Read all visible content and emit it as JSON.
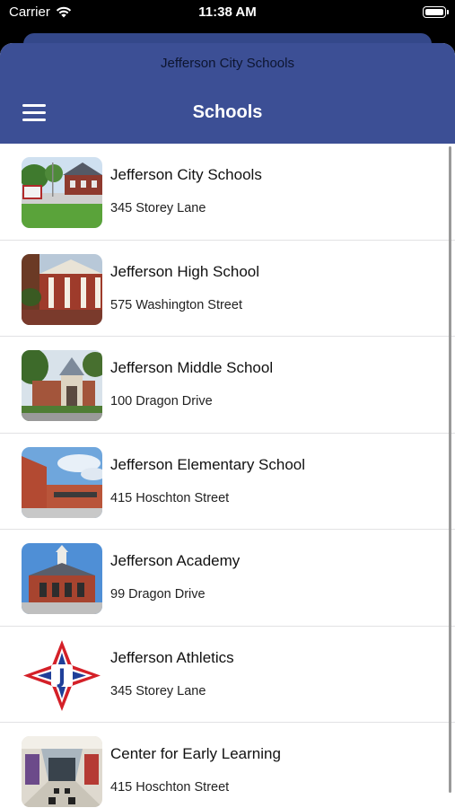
{
  "status_bar": {
    "carrier": "Carrier",
    "time": "11:38 AM"
  },
  "header": {
    "parent_title": "Jefferson City Schools",
    "title": "Schools"
  },
  "colors": {
    "header_bg": "#3c4f95",
    "title_text": "#ffffff"
  },
  "schools": [
    {
      "name": "Jefferson City Schools",
      "address": "345 Storey Lane",
      "icon": "building-photo"
    },
    {
      "name": "Jefferson High School",
      "address": "575 Washington Street",
      "icon": "building-photo"
    },
    {
      "name": "Jefferson Middle School",
      "address": "100 Dragon Drive",
      "icon": "building-photo"
    },
    {
      "name": "Jefferson Elementary School",
      "address": "415 Hoschton Street",
      "icon": "building-photo"
    },
    {
      "name": "Jefferson Academy",
      "address": "99 Dragon Drive",
      "icon": "building-photo"
    },
    {
      "name": "Jefferson Athletics",
      "address": "345 Storey Lane",
      "icon": "j-diamond-logo"
    },
    {
      "name": "Center for Early Learning",
      "address": "415 Hoschton Street",
      "icon": "hallway-photo"
    }
  ]
}
